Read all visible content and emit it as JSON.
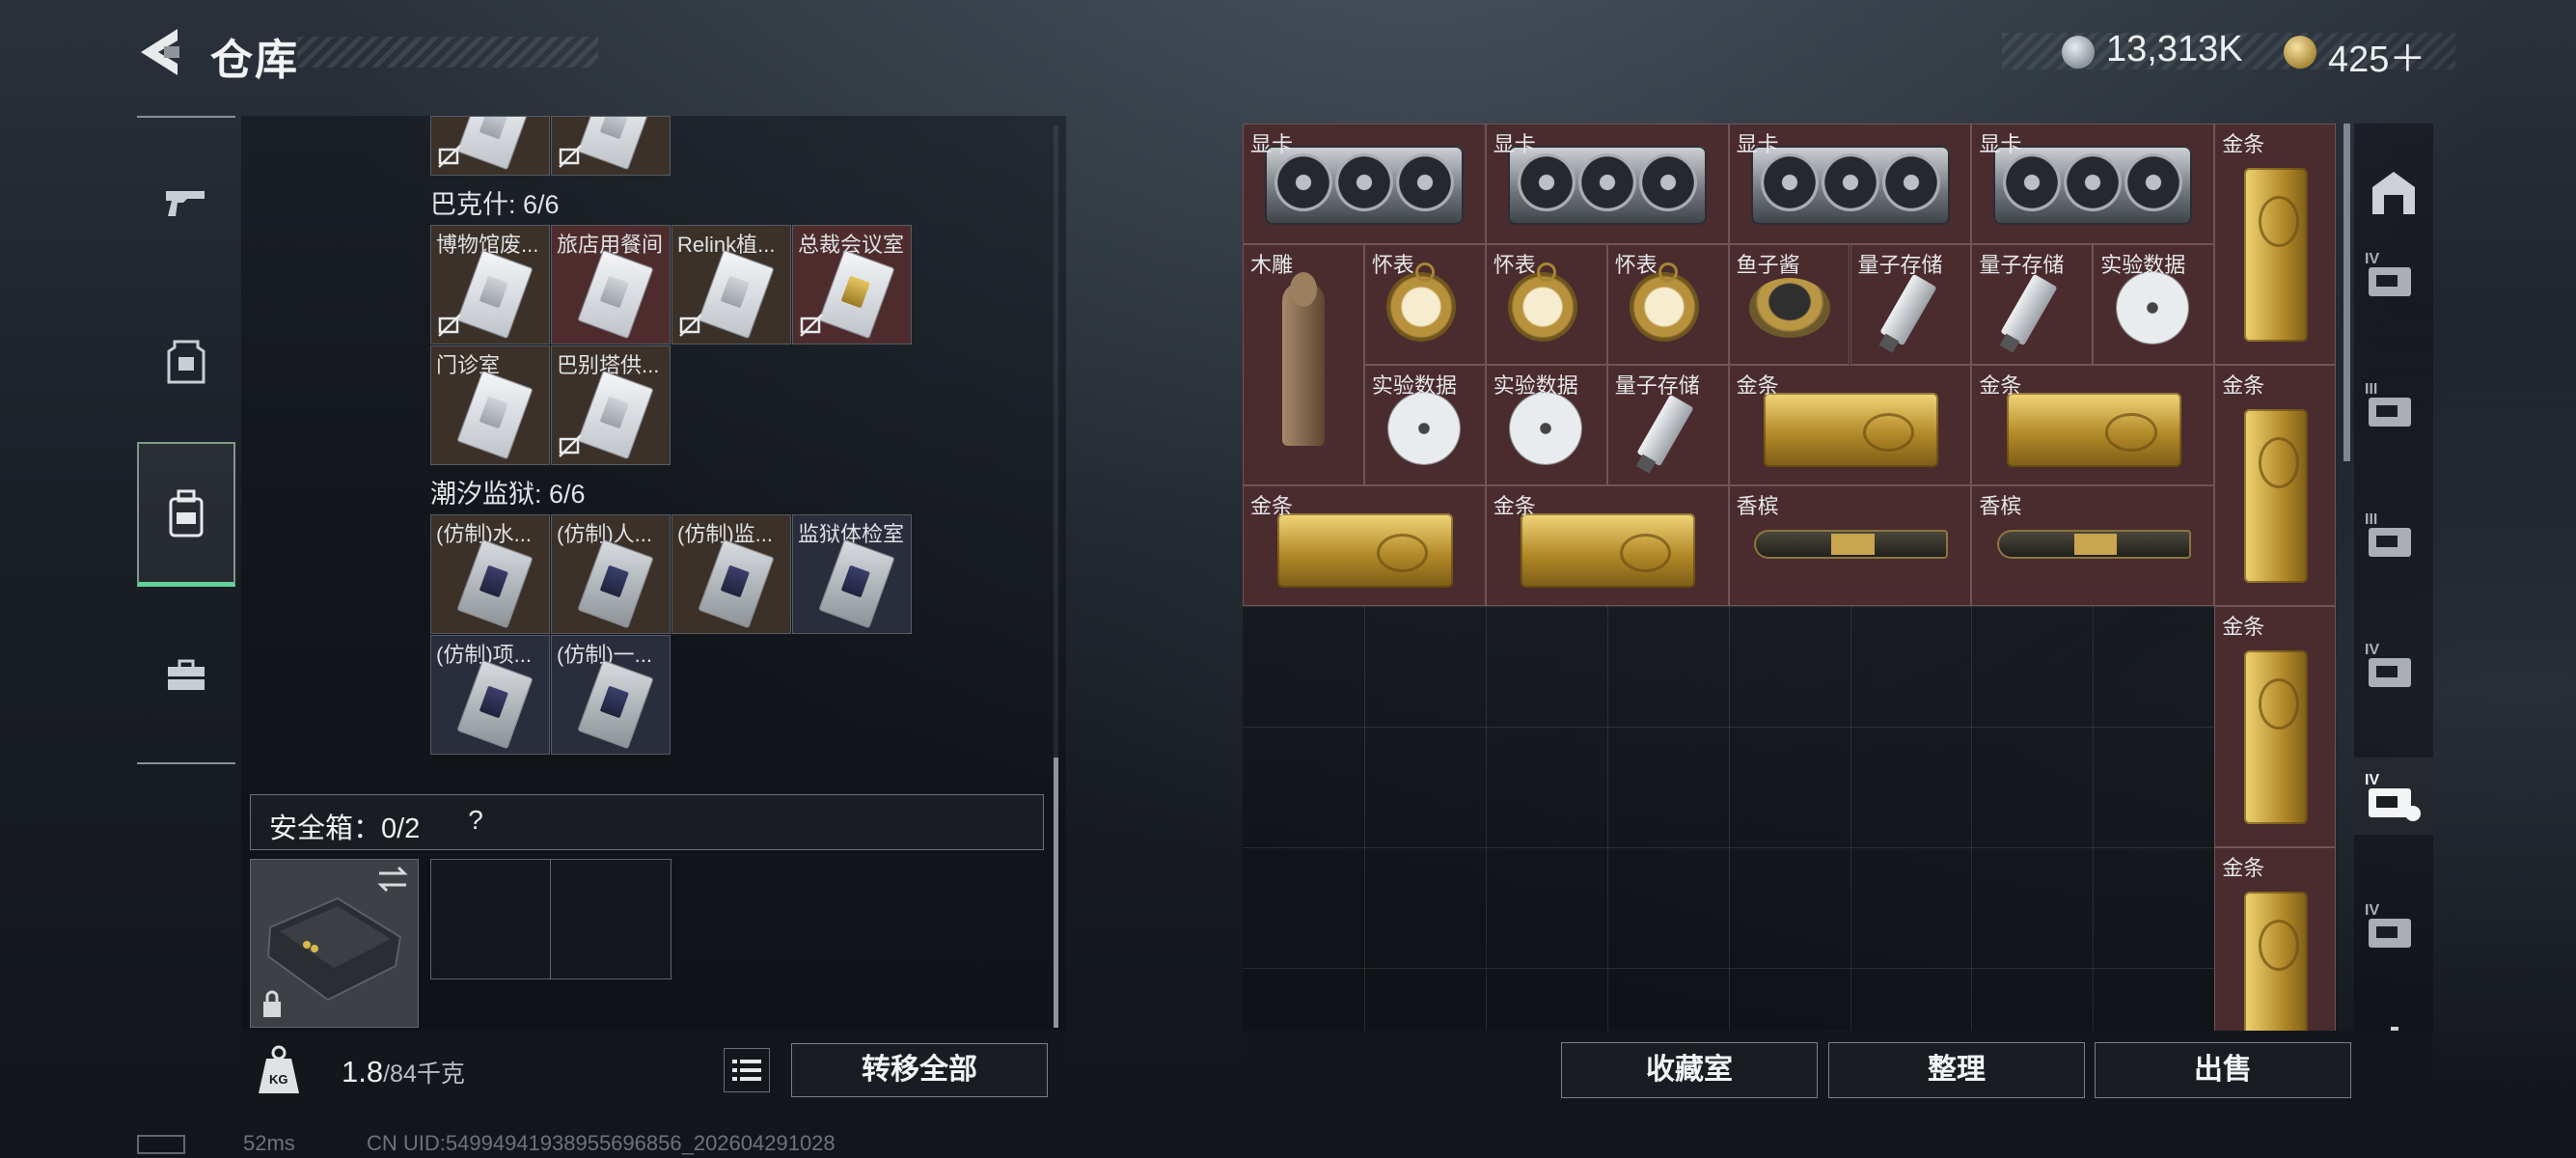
{
  "header": {
    "title": "仓库",
    "currency1": "13,313K",
    "currency2": "425＋"
  },
  "left_nav": {
    "items": [
      {
        "icon": "gun-icon"
      },
      {
        "icon": "armor-icon"
      },
      {
        "icon": "backpack-icon",
        "active": true
      },
      {
        "icon": "toolbox-icon"
      }
    ]
  },
  "container": {
    "top_row": [
      {
        "locked": true
      },
      {
        "locked": true
      }
    ],
    "sections": [
      {
        "header": "巴克什: 6/6",
        "items": [
          {
            "label": "博物馆废...",
            "color": "brown",
            "locked": true
          },
          {
            "label": "旅店用餐间",
            "color": "red",
            "locked": false
          },
          {
            "label": "Relink植...",
            "color": "brown",
            "locked": true
          },
          {
            "label": "总裁会议室",
            "color": "red",
            "locked": true,
            "gold": true
          },
          {
            "label": "门诊室",
            "color": "brown",
            "locked": false
          },
          {
            "label": "巴别塔供...",
            "color": "brown",
            "locked": true
          }
        ]
      },
      {
        "header": "潮汐监狱: 6/6",
        "items": [
          {
            "label": "(仿制)水...",
            "color": "brown"
          },
          {
            "label": "(仿制)人...",
            "color": "brown"
          },
          {
            "label": "(仿制)监...",
            "color": "brown"
          },
          {
            "label": "监狱体检室",
            "color": "blue"
          },
          {
            "label": "(仿制)项...",
            "color": "blue"
          },
          {
            "label": "(仿制)一...",
            "color": "blue",
            "gold": true
          }
        ]
      }
    ]
  },
  "safe": {
    "label": "安全箱：0/2",
    "help": "?"
  },
  "left_bottom": {
    "weight_value": "1.8",
    "weight_cap": "/84千克",
    "transfer_all": "转移全部"
  },
  "stash_items": [
    {
      "label": "显卡",
      "type": "gpu"
    },
    {
      "label": "显卡",
      "type": "gpu"
    },
    {
      "label": "显卡",
      "type": "gpu"
    },
    {
      "label": "显卡",
      "type": "gpu"
    },
    {
      "label": "金条",
      "type": "goldbar-v"
    },
    {
      "label": "木雕",
      "type": "statue"
    },
    {
      "label": "怀表",
      "type": "watch"
    },
    {
      "label": "怀表",
      "type": "watch"
    },
    {
      "label": "怀表",
      "type": "watch"
    },
    {
      "label": "鱼子酱",
      "type": "caviar"
    },
    {
      "label": "量子存储",
      "type": "usb"
    },
    {
      "label": "量子存储",
      "type": "usb"
    },
    {
      "label": "实验数据",
      "type": "disc"
    },
    {
      "label": "实验数据",
      "type": "disc"
    },
    {
      "label": "实验数据",
      "type": "disc"
    },
    {
      "label": "量子存储",
      "type": "usb"
    },
    {
      "label": "金条",
      "type": "goldbar-h"
    },
    {
      "label": "金条",
      "type": "goldbar-h"
    },
    {
      "label": "金条",
      "type": "goldbar-v"
    },
    {
      "label": "金条",
      "type": "goldbar-h"
    },
    {
      "label": "金条",
      "type": "goldbar-h"
    },
    {
      "label": "香槟",
      "type": "champagne"
    },
    {
      "label": "香槟",
      "type": "champagne"
    },
    {
      "label": "金条",
      "type": "goldbar-v"
    },
    {
      "label": "金条",
      "type": "goldbar-v"
    }
  ],
  "right_nav": {
    "items": [
      {
        "icon": "stash-home-icon"
      },
      {
        "icon": "stash-tier-add-icon",
        "tier": "IV"
      },
      {
        "icon": "stash-tier-repair-icon",
        "tier": "III"
      },
      {
        "icon": "stash-tier-box-icon",
        "tier": "III"
      },
      {
        "icon": "stash-tier-gun-icon",
        "tier": "IV"
      },
      {
        "icon": "stash-tier-case-icon",
        "tier": "IV",
        "active": true
      },
      {
        "icon": "stash-tier-folder-icon",
        "tier": "IV"
      }
    ]
  },
  "right_bottom": {
    "collection": "收藏室",
    "sort": "整理",
    "sell": "出售"
  },
  "status": {
    "ping": "52ms",
    "uid": "CN UID:54994941938955696856_202604291028"
  }
}
